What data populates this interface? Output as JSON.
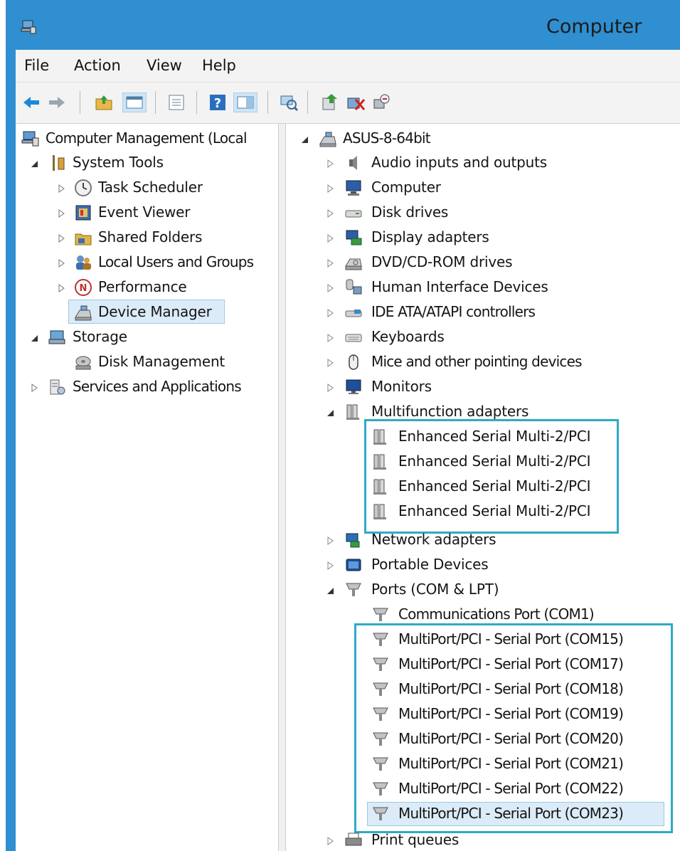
{
  "window": {
    "title": "Computer"
  },
  "menu": [
    "File",
    "Action",
    "View",
    "Help"
  ],
  "toolbar": {
    "buttons": [
      "back-arrow-icon",
      "forward-arrow-icon",
      "up-folder-icon",
      "show-hide-console-tree-icon",
      "properties-icon",
      "help-icon",
      "show-hide-action-pane-icon",
      "scan-hardware-icon",
      "update-driver-icon",
      "disable-device-icon",
      "uninstall-device-icon"
    ]
  },
  "left_tree": {
    "root": "Computer Management (Local",
    "system_tools": "System Tools",
    "system_tools_items": [
      "Task Scheduler",
      "Event Viewer",
      "Shared Folders",
      "Local Users and Groups",
      "Performance",
      "Device Manager"
    ],
    "storage": "Storage",
    "storage_items": [
      "Disk Management"
    ],
    "services": "Services and Applications"
  },
  "device_tree": {
    "root": "ASUS-8-64bit",
    "categories_top": [
      "Audio inputs and outputs",
      "Computer",
      "Disk drives",
      "Display adapters",
      "DVD/CD-ROM drives",
      "Human Interface Devices",
      "IDE ATA/ATAPI controllers",
      "Keyboards",
      "Mice and other pointing devices",
      "Monitors"
    ],
    "multifunction": {
      "label": "Multifunction adapters",
      "children": [
        "Enhanced Serial Multi-2/PCI",
        "Enhanced Serial Multi-2/PCI",
        "Enhanced Serial Multi-2/PCI",
        "Enhanced Serial Multi-2/PCI"
      ]
    },
    "categories_mid": [
      "Network adapters",
      "Portable Devices"
    ],
    "ports": {
      "label": "Ports (COM & LPT)",
      "children": [
        "Communications Port (COM1)",
        "MultiPort/PCI - Serial Port (COM15)",
        "MultiPort/PCI - Serial Port (COM17)",
        "MultiPort/PCI - Serial Port (COM18)",
        "MultiPort/PCI - Serial Port (COM19)",
        "MultiPort/PCI - Serial Port (COM20)",
        "MultiPort/PCI - Serial Port (COM21)",
        "MultiPort/PCI - Serial Port (COM22)",
        "MultiPort/PCI - Serial Port (COM23)"
      ]
    },
    "categories_bottom": [
      "Print queues"
    ]
  },
  "colors": {
    "title_bar": "#2f8fd0",
    "highlight_border": "#2eabc4",
    "selection": "#dcebf8"
  }
}
